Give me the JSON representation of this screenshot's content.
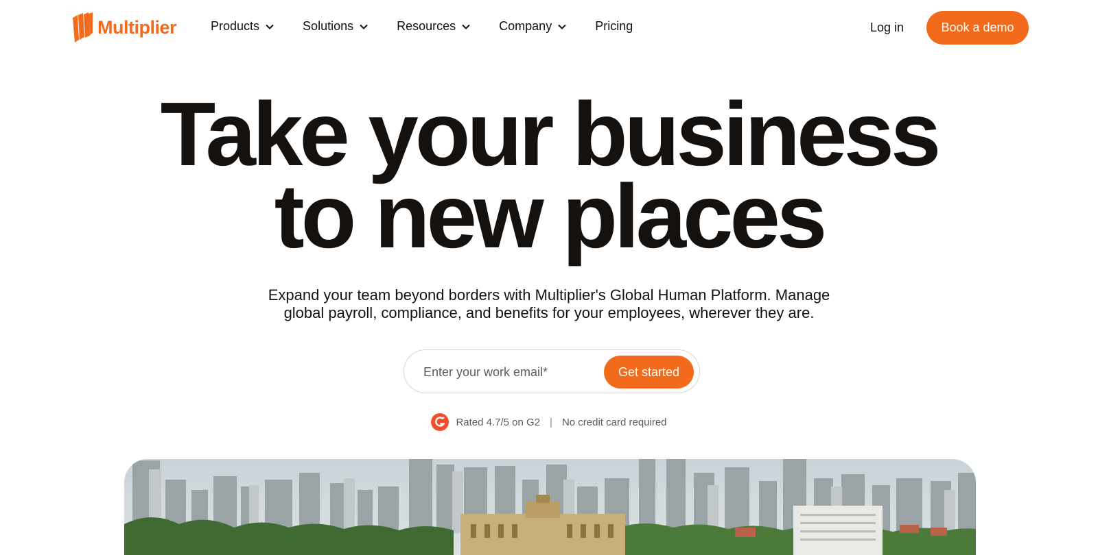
{
  "brand": {
    "name": "Multiplier",
    "accent": "#f26b1d",
    "text_color": "#15110e"
  },
  "nav": {
    "items": [
      {
        "label": "Products",
        "has_dropdown": true
      },
      {
        "label": "Solutions",
        "has_dropdown": true
      },
      {
        "label": "Resources",
        "has_dropdown": true
      },
      {
        "label": "Company",
        "has_dropdown": true
      },
      {
        "label": "Pricing",
        "has_dropdown": false
      }
    ],
    "login_label": "Log in",
    "demo_label": "Book a demo"
  },
  "hero": {
    "title_line1": "Take your business",
    "title_line2": "to new places",
    "subtitle_line1": "Expand your team beyond borders with Multiplier's Global Human Platform. Manage",
    "subtitle_line2": "global payroll, compliance, and benefits for your employees, wherever they are.",
    "email_placeholder": "Enter your work email*",
    "email_value": "",
    "cta_label": "Get started",
    "rating_text": "Rated 4.7/5 on G2",
    "separator": "|",
    "no_card_text": "No credit card required",
    "g2_icon": "g2-logo-icon",
    "image": "city-skyline-photo"
  }
}
